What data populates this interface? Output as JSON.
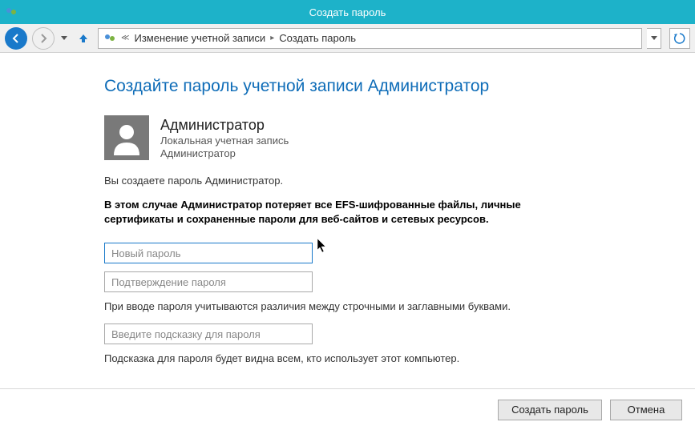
{
  "window": {
    "title": "Создать пароль"
  },
  "breadcrumb": {
    "item1": "Изменение учетной записи",
    "item2": "Создать пароль"
  },
  "page": {
    "heading": "Создайте пароль учетной записи Администратор"
  },
  "user": {
    "name": "Администратор",
    "account_type": "Локальная учетная запись",
    "role": "Администратор"
  },
  "texts": {
    "intro": "Вы создаете пароль Администратор.",
    "warning": "В этом случае Администратор потеряет все EFS-шифрованные файлы, личные сертификаты и сохраненные пароли для веб-сайтов и сетевых ресурсов.",
    "case_hint": "При вводе пароля учитываются различия между строчными и заглавными буквами.",
    "hint_visibility": "Подсказка для пароля будет видна всем, кто использует этот компьютер."
  },
  "fields": {
    "new_password_placeholder": "Новый пароль",
    "confirm_password_placeholder": "Подтверждение пароля",
    "hint_placeholder": "Введите подсказку для пароля"
  },
  "buttons": {
    "create": "Создать пароль",
    "cancel": "Отмена"
  }
}
